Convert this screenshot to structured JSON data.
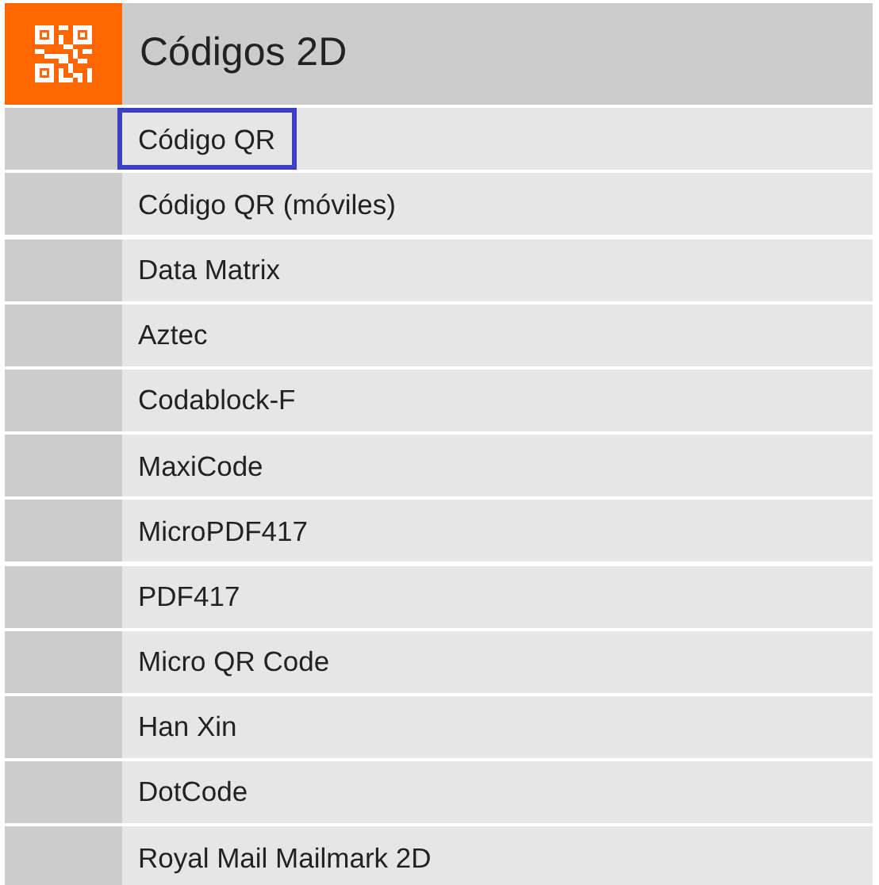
{
  "header": {
    "title": "Códigos 2D"
  },
  "items": [
    {
      "label": "Código QR",
      "focused": true
    },
    {
      "label": "Código QR (móviles)",
      "focused": false
    },
    {
      "label": "Data Matrix",
      "focused": false
    },
    {
      "label": "Aztec",
      "focused": false
    },
    {
      "label": "Codablock-F",
      "focused": false
    },
    {
      "label": "MaxiCode",
      "focused": false
    },
    {
      "label": "MicroPDF417",
      "focused": false
    },
    {
      "label": "PDF417",
      "focused": false
    },
    {
      "label": "Micro QR Code",
      "focused": false
    },
    {
      "label": "Han Xin",
      "focused": false
    },
    {
      "label": "DotCode",
      "focused": false
    },
    {
      "label": "Royal Mail Mailmark 2D",
      "focused": false
    }
  ]
}
